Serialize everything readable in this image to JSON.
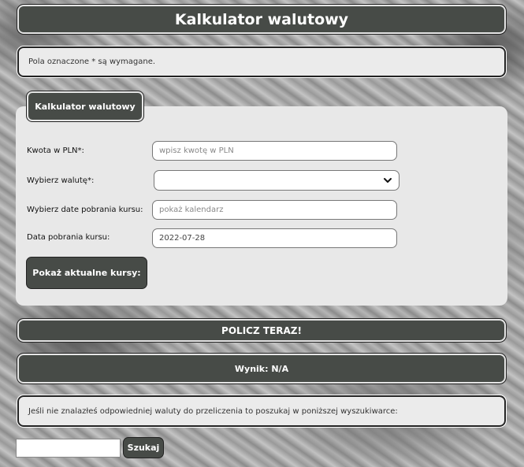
{
  "header": {
    "title": "Kalkulator walutowy"
  },
  "notice": {
    "text": "Pola oznaczone * są wymagane."
  },
  "form": {
    "tab_label": "Kalkulator walutowy",
    "amount": {
      "label": "Kwota w PLN*:",
      "placeholder": "wpisz kwotę w PLN",
      "value": ""
    },
    "currency": {
      "label": "Wybierz walutę*:",
      "value": ""
    },
    "date_picker": {
      "label": "Wybierz date pobrania kursu:",
      "placeholder": "pokaż kalendarz",
      "value": ""
    },
    "rate_date": {
      "label": "Data pobrania kursu:",
      "value": "2022-07-28"
    },
    "show_rates_label": "Pokaż aktualne kursy:"
  },
  "calculate": {
    "label": "POLICZ TERAZ!"
  },
  "result": {
    "text": "Wynik: N/A"
  },
  "info": {
    "text": "Jeśli nie znalazłeś odpowiedniej waluty do przeliczenia to poszukaj w poniższej wyszukiwarce:"
  },
  "search": {
    "value": "",
    "button_label": "Szukaj"
  },
  "icons": {
    "select_arrow": "chevron-down-icon"
  },
  "colors": {
    "dark": "#474b47",
    "panel": "#e8e8e8"
  }
}
